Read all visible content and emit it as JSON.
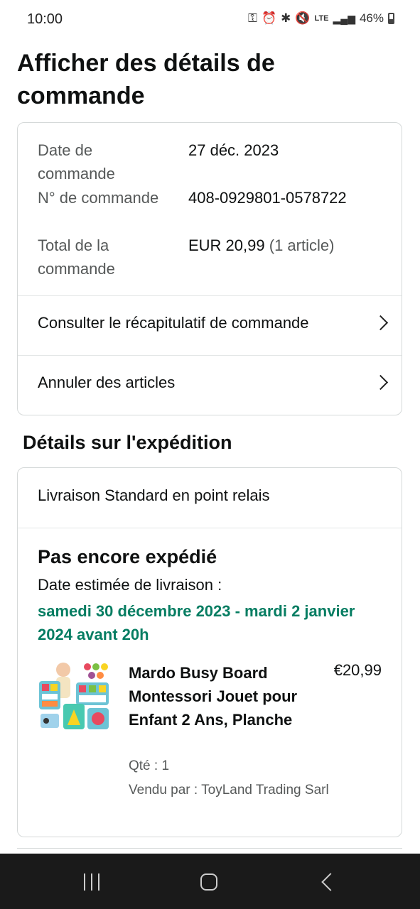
{
  "status_bar": {
    "time": "10:00",
    "network": "LTE",
    "battery": "46%"
  },
  "page_title": "Afficher des détails de commande",
  "order_summary": {
    "rows": [
      {
        "label": "Date de commande",
        "value": "27 déc. 2023",
        "extra": ""
      },
      {
        "label": "N° de commande",
        "value": "408-0929801-0578722",
        "extra": ""
      },
      {
        "label": "Total de la commande",
        "value": "EUR 20,99",
        "extra": "(1 article)"
      }
    ],
    "links": [
      {
        "label": "Consulter le récapitulatif de commande"
      },
      {
        "label": "Annuler des articles"
      }
    ]
  },
  "shipping": {
    "section_title": "Détails sur l'expédition",
    "method": "Livraison Standard en point relais",
    "status": "Pas encore expédié",
    "estimated_label": "Date estimée de livraison :",
    "estimated_date": "samedi 30 décembre 2023 - mardi 2 janvier 2024 avant 20h",
    "date_color": "#067d62"
  },
  "product": {
    "name": "Mardo Busy Board Montessori Jouet pour Enfant 2 Ans, Planche",
    "price": "€20,99",
    "quantity": "Qté : 1",
    "seller": "Vendu par : ToyLand Trading Sarl"
  },
  "nav_bar": {
    "buttons": [
      "recent-apps",
      "home",
      "back"
    ]
  }
}
